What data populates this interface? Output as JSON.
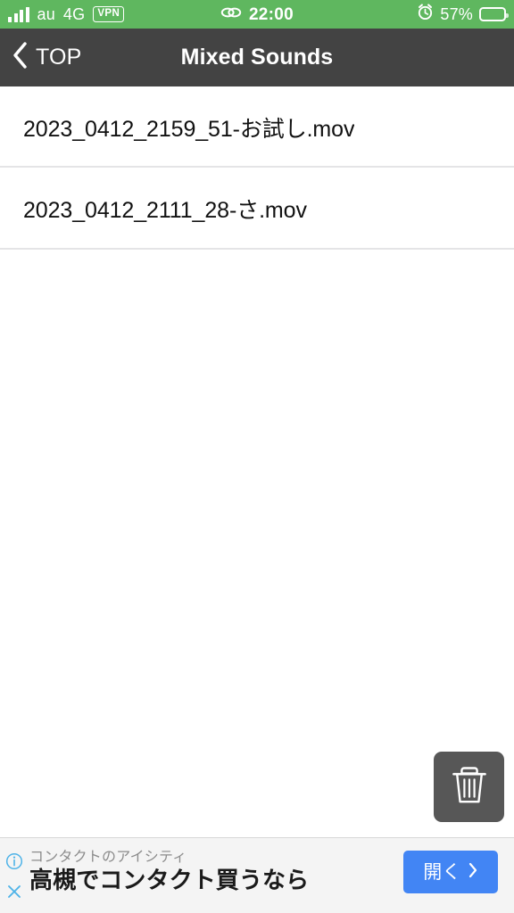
{
  "status_bar": {
    "background_color": "#5fb75f",
    "signal_icon": "signal-bars-icon",
    "carrier": "au",
    "network": "4G",
    "vpn_badge": "VPN",
    "chain_icon": "chain-link-icon",
    "time": "22:00",
    "alarm_icon": "alarm-clock-icon",
    "battery_percent": "57%",
    "battery_level": 57,
    "battery_icon": "battery-icon"
  },
  "nav": {
    "background_color": "#434343",
    "back_icon": "chevron-left-icon",
    "back_label": "TOP",
    "title": "Mixed Sounds"
  },
  "list": {
    "items": [
      {
        "label": "2023_0412_2159_51-お試し.mov"
      },
      {
        "label": "2023_0412_2111_28-さ.mov"
      }
    ]
  },
  "delete_button": {
    "icon": "trash-icon",
    "background_color": "#575757"
  },
  "ad": {
    "advertiser": "コンタクトのアイシティ",
    "headline": "高槻でコンタクト買うなら",
    "cta_label": "開く",
    "cta_chevron_icon": "chevron-right-icon",
    "cta_color": "#4285f4",
    "info_icon": "info-circle-icon",
    "close_icon": "close-x-icon"
  }
}
